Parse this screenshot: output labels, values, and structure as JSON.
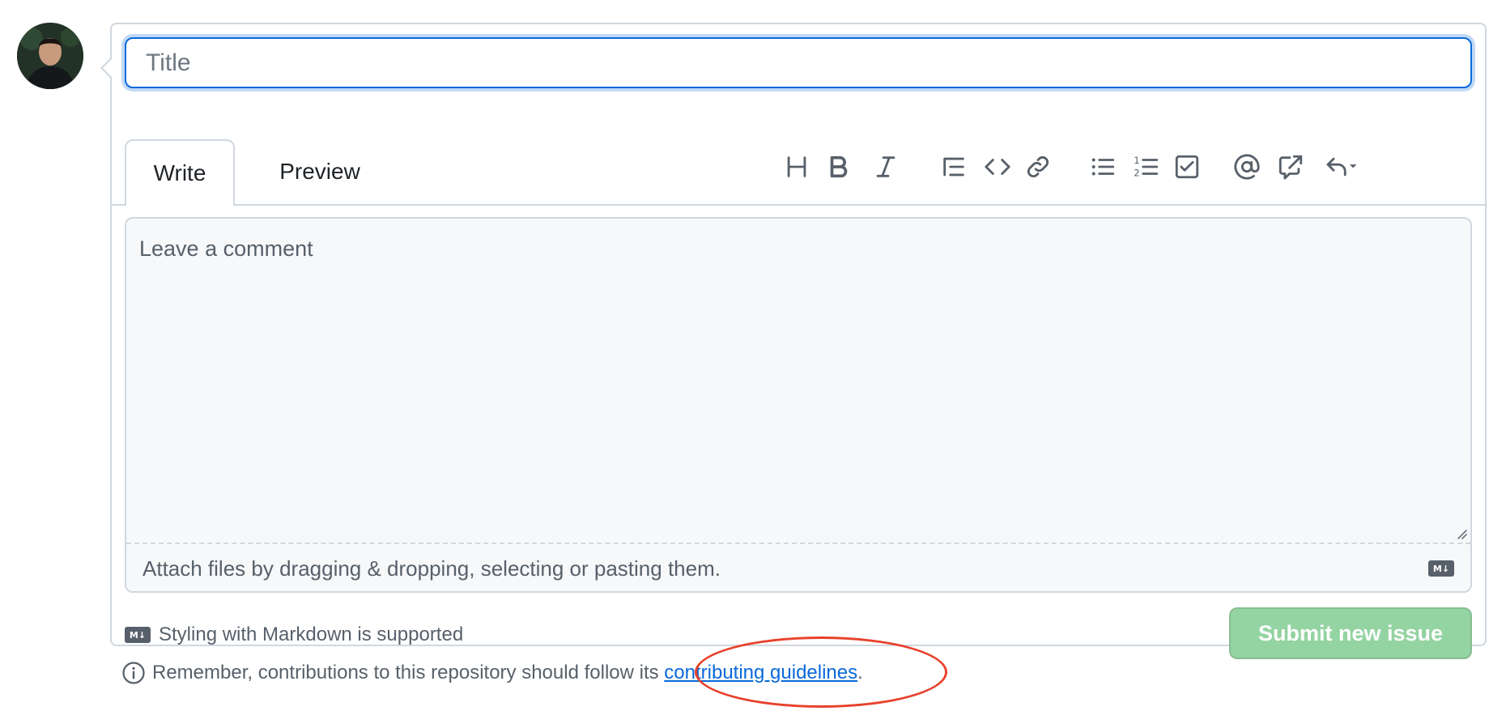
{
  "title_input": {
    "placeholder": "Title",
    "value": ""
  },
  "tabs": {
    "write": "Write",
    "preview": "Preview"
  },
  "toolbar": [
    {
      "name": "heading-icon",
      "label": "Heading"
    },
    {
      "name": "bold-icon",
      "label": "Bold"
    },
    {
      "name": "italic-icon",
      "label": "Italic"
    },
    {
      "name": "quote-icon",
      "label": "Quote"
    },
    {
      "name": "code-icon",
      "label": "Code"
    },
    {
      "name": "link-icon",
      "label": "Link"
    },
    {
      "name": "unordered-list-icon",
      "label": "Bulleted list"
    },
    {
      "name": "ordered-list-icon",
      "label": "Numbered list"
    },
    {
      "name": "task-list-icon",
      "label": "Task list"
    },
    {
      "name": "mention-icon",
      "label": "Mention"
    },
    {
      "name": "cross-reference-icon",
      "label": "Reference"
    },
    {
      "name": "saved-replies-icon",
      "label": "Saved replies"
    }
  ],
  "comment": {
    "placeholder": "Leave a comment"
  },
  "attach_text": "Attach files by dragging & dropping, selecting or pasting them.",
  "markdown_badge": "M↓",
  "markdown_note": "Styling with Markdown is supported",
  "submit_label": "Submit new issue",
  "remember": {
    "prefix": "Remember, contributions to this repository should follow its ",
    "link_text": "contributing guidelines",
    "suffix": "."
  },
  "colors": {
    "focus_blue": "#0969da",
    "submit_disabled_green": "#94d3a2",
    "annotation_red": "#e8412b",
    "border": "#d0d7de"
  }
}
